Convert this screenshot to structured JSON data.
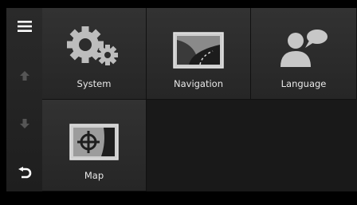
{
  "sidebar": {
    "menu_icon": "hamburger-menu-icon",
    "up_icon": "arrow-up-icon",
    "down_icon": "arrow-down-icon",
    "back_icon": "back-arrow-icon"
  },
  "tiles": [
    {
      "label": "System",
      "icon": "gears-icon"
    },
    {
      "label": "Navigation",
      "icon": "navigation-road-icon"
    },
    {
      "label": "Language",
      "icon": "language-speaker-icon"
    },
    {
      "label": "Map",
      "icon": "map-crosshair-icon"
    }
  ]
}
